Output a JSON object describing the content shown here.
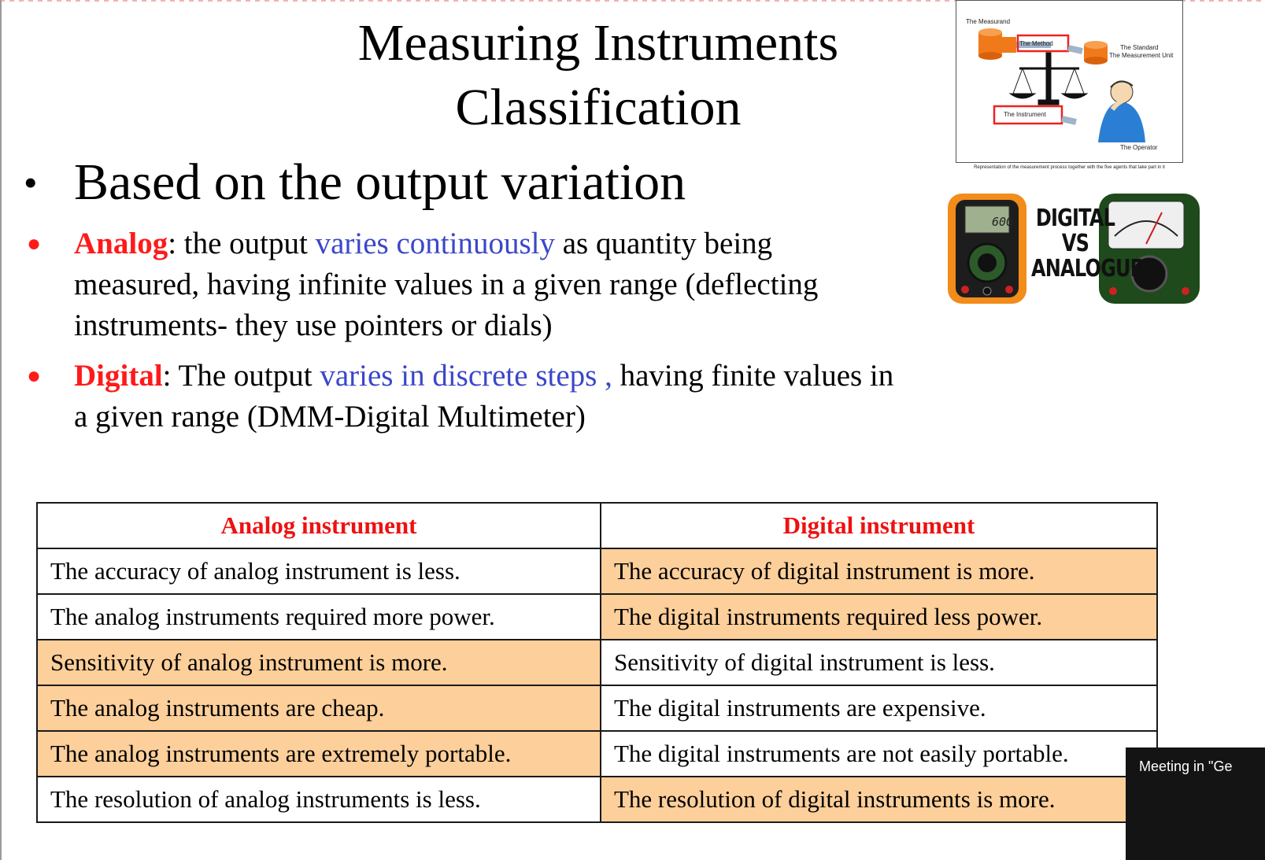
{
  "slide": {
    "title_line1": "Measuring Instruments",
    "title_line2": "Classification",
    "main_bullet": "Based on  the output variation",
    "analog": {
      "key": "Analog",
      "text_a": ": the output ",
      "highlight": "varies continuously",
      "text_b": " as quantity being",
      "line2": "measured, having infinite values in a given range (deflecting",
      "line3": "instruments- they use pointers or dials)"
    },
    "digital": {
      "key": "Digital",
      "text_a": ": The output ",
      "highlight": "varies in discrete steps ,",
      "text_b": " having finite values in",
      "line2": "a given range (DMM-Digital Multimeter)"
    },
    "table": {
      "headers": [
        "Analog instrument",
        "Digital instrument"
      ],
      "rows": [
        {
          "analog": "The accuracy of analog instrument is less.",
          "digital": "The accuracy of digital instrument is more.",
          "highlight": "digital"
        },
        {
          "analog": "The analog instruments required more power.",
          "digital": "The digital instruments required less power.",
          "highlight": "digital"
        },
        {
          "analog": "Sensitivity of analog instrument is more.",
          "digital": "Sensitivity of digital instrument is less.",
          "highlight": "analog"
        },
        {
          "analog": "The analog instruments are cheap.",
          "digital": "The digital instruments are expensive.",
          "highlight": "analog"
        },
        {
          "analog": "The analog instruments are extremely portable.",
          "digital": "The digital instruments are not easily portable.",
          "highlight": "analog"
        },
        {
          "analog": "The resolution of analog instruments is less.",
          "digital": "The resolution of digital instruments is more.",
          "highlight": "digital"
        }
      ]
    },
    "diagram": {
      "measurand": "The Measurand",
      "method": "The Method",
      "standard": "The Standard",
      "unit": "The Measurement Unit",
      "instrument": "The Instrument",
      "operator": "The Operator",
      "caption": "Representation of the measurement process together with the five agents that take part in it"
    },
    "meters_image": {
      "line1": "DIGITAL",
      "line2": "VS",
      "line3": "ANALOGUE",
      "display": "600"
    },
    "colors": {
      "key_red": "#ff1a1a",
      "highlight_blue": "#3b47c9",
      "cell_orange": "#fdcf9a"
    }
  },
  "overlay": {
    "meeting_toast": "Meeting in \"Ge"
  }
}
